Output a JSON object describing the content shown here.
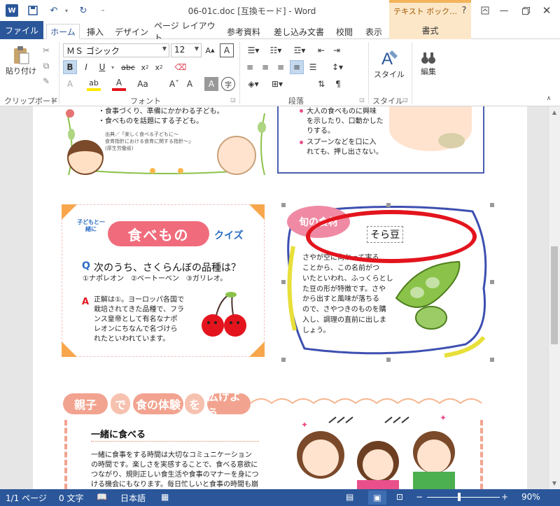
{
  "titlebar": {
    "title": "06-01c.doc [互換モード] - Word",
    "context_tab_header": "テキスト ボック…",
    "help_label": "?",
    "undo_icon": "undo-icon",
    "redo_icon": "redo-icon",
    "save_icon": "save-icon"
  },
  "tabs": {
    "file": "ファイル",
    "home": "ホーム",
    "insert": "挿入",
    "design": "デザイン",
    "layout": "ページ レイアウト",
    "references": "参考資料",
    "mailings": "差し込み文書",
    "review": "校閲",
    "view": "表示",
    "format": "書式"
  },
  "ribbon": {
    "paste_label": "貼り付け",
    "clipboard_group": "クリップボード",
    "font_name": "ＭＳ ゴシック",
    "font_size": "12",
    "font_group": "フォント",
    "paragraph_group": "段落",
    "styles_label": "スタイル",
    "styles_group": "スタイル",
    "editing_label": "編集"
  },
  "document": {
    "top_left_lines": [
      "・食事づくり、準備にかかわる子ども。",
      "・食べものを話題にする子ども。"
    ],
    "top_left_source": "出典／「楽しく食べる子どもに～\n食育指針における食育に関する指針～」\n(厚生労働省)",
    "top_right_lines": [
      "大人の食べものに興味",
      "を示したり、口動かした",
      "りする。",
      "スプーンなどを口に入",
      "れても、押し出さない。"
    ],
    "quiz_title_small": "子どもと一緒に",
    "quiz_title": "食べもの",
    "quiz_title_suffix": "クイズ",
    "question_mark": "Q",
    "question": "次のうち、さくらんぼの品種は？",
    "options": "①ナポレオン　②ベートーベン　③ガリレオ。",
    "answer_mark": "A",
    "answer_lines": [
      "正解は①。ヨーロッパ各国で",
      "栽培されてきた品種で、フラ",
      "ンス皇帝として有名なナポ",
      "レオンにちなんで名づけら",
      "れたといわれています。"
    ],
    "fresh_title": "旬の食材",
    "fresh_name": "そら豆",
    "fresh_lines": [
      "さやが空に向かって実る",
      "ことから、この名前がつ",
      "いたといわれ、ふっくらとし",
      "た豆の形が特徴です。さや",
      "から出すと風味が落ちる",
      "ので、さやつきのものを購",
      "入し、調理の直前に出しま",
      "しょう。"
    ],
    "band_chips": [
      "親子",
      "で",
      "食の体験",
      "を",
      "広げよう"
    ],
    "section_heading": "一緒に食べる",
    "section_lines": [
      "一緒に食事をする時間は大切なコミュニケーション",
      "の時間です。楽しさを実感することで、食べる意欲に",
      "つながり、規則正しい食生活や食事のマナーを身につ",
      "ける機会にもなります。毎日忙しいと食事の時間も崩"
    ]
  },
  "status": {
    "page": "1/1 ページ",
    "words": "0 文字",
    "language": "日本語",
    "zoom": "90%",
    "zoom_level": 0.9
  },
  "colors": {
    "word_blue": "#2b579a",
    "context_orange": "#fde7c9",
    "annotation_red": "#e3141d"
  }
}
